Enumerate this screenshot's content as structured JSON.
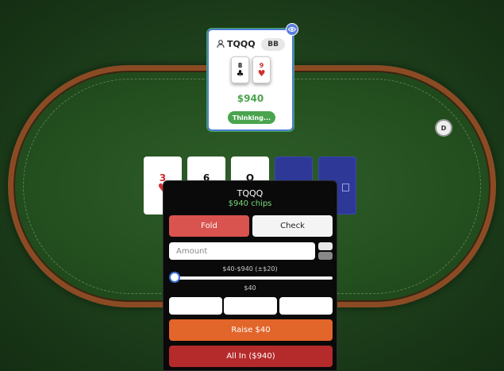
{
  "opponent": {
    "name": "TQQQ",
    "position": "BB",
    "stack": "$940",
    "status": "Thinking...",
    "cards": [
      {
        "rank": "8",
        "suit": "♣",
        "color": "#111111"
      },
      {
        "rank": "9",
        "suit": "♥",
        "color": "#d03030"
      }
    ]
  },
  "dealer_button": "D",
  "community_cards": [
    {
      "rank": "3",
      "suit": "♥",
      "color": "#d03030"
    },
    {
      "rank": "6",
      "suit": "",
      "color": "#111111"
    },
    {
      "rank": "Q",
      "suit": "",
      "color": "#111111"
    }
  ],
  "action_panel": {
    "player_name": "TQQQ",
    "chips": "$940 chips",
    "fold_label": "Fold",
    "check_label": "Check",
    "amount_placeholder": "Amount",
    "range_text": "$40-$940 (±$20)",
    "current_bet": "$40",
    "raise_label": "Raise $40",
    "allin_label": "All In ($940)",
    "slider_fraction": 0.0
  },
  "colors": {
    "felt": "#24501f",
    "rail": "#8a4b24",
    "accent_green": "#4aa44e",
    "fold": "#d9534f",
    "raise": "#e2652a",
    "allin": "#b52a2a",
    "card_back": "#2d3897"
  }
}
